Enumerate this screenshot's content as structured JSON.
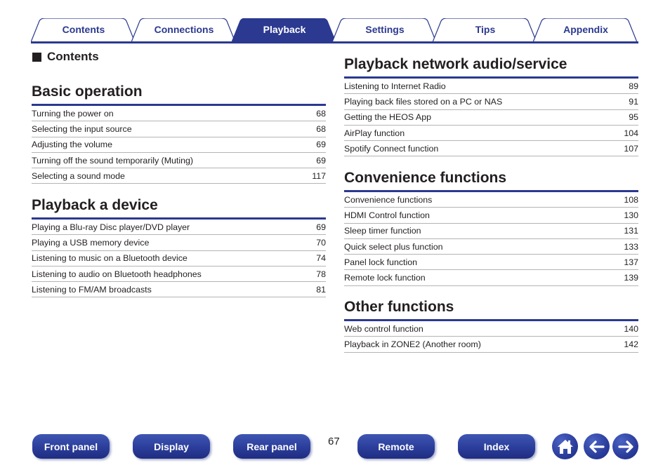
{
  "tabs": [
    {
      "label": "Contents",
      "active": false
    },
    {
      "label": "Connections",
      "active": false
    },
    {
      "label": "Playback",
      "active": true
    },
    {
      "label": "Settings",
      "active": false
    },
    {
      "label": "Tips",
      "active": false
    },
    {
      "label": "Appendix",
      "active": false
    }
  ],
  "contents_heading": "Contents",
  "sections": {
    "basic": {
      "title": "Basic operation",
      "items": [
        {
          "title": "Turning the power on",
          "page": "68"
        },
        {
          "title": "Selecting the input source",
          "page": "68"
        },
        {
          "title": "Adjusting the volume",
          "page": "69"
        },
        {
          "title": "Turning off the sound temporarily (Muting)",
          "page": "69"
        },
        {
          "title": "Selecting a sound mode",
          "page": "117"
        }
      ]
    },
    "device": {
      "title": "Playback a device",
      "items": [
        {
          "title": "Playing a Blu-ray Disc player/DVD player",
          "page": "69"
        },
        {
          "title": "Playing a USB memory device",
          "page": "70"
        },
        {
          "title": "Listening to music on a Bluetooth device",
          "page": "74"
        },
        {
          "title": "Listening to audio on Bluetooth headphones",
          "page": "78"
        },
        {
          "title": "Listening to FM/AM broadcasts",
          "page": "81"
        }
      ]
    },
    "network": {
      "title": "Playback network audio/service",
      "items": [
        {
          "title": "Listening to Internet Radio",
          "page": "89"
        },
        {
          "title": "Playing back files stored on a PC or NAS",
          "page": "91"
        },
        {
          "title": "Getting the HEOS App",
          "page": "95"
        },
        {
          "title": "AirPlay function",
          "page": "104"
        },
        {
          "title": "Spotify Connect function",
          "page": "107"
        }
      ]
    },
    "convenience": {
      "title": "Convenience functions",
      "items": [
        {
          "title": "Convenience functions",
          "page": "108"
        },
        {
          "title": "HDMI Control function",
          "page": "130"
        },
        {
          "title": "Sleep timer function",
          "page": "131"
        },
        {
          "title": "Quick select plus function",
          "page": "133"
        },
        {
          "title": "Panel lock function",
          "page": "137"
        },
        {
          "title": "Remote lock function",
          "page": "139"
        }
      ]
    },
    "other": {
      "title": "Other functions",
      "items": [
        {
          "title": "Web control function",
          "page": "140"
        },
        {
          "title": "Playback in ZONE2 (Another room)",
          "page": "142"
        }
      ]
    }
  },
  "bottom_nav": {
    "buttons": [
      "Front panel",
      "Display",
      "Rear panel",
      "Remote",
      "Index"
    ],
    "page_number": "67",
    "icons": [
      "home-icon",
      "back-arrow-icon",
      "forward-arrow-icon"
    ]
  },
  "colors": {
    "accent": "#2b3990",
    "tab_inactive_bg": "#ffffff",
    "row_divider": "#b4b4b4",
    "text": "#231f20"
  }
}
